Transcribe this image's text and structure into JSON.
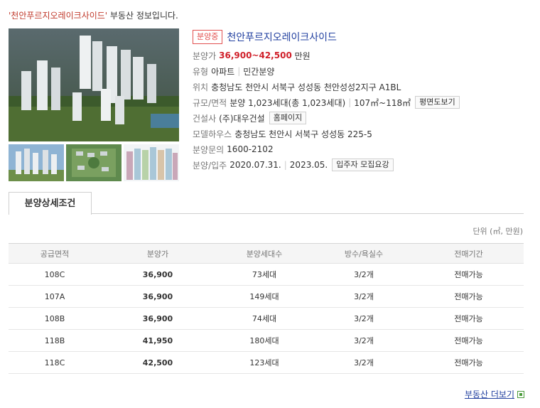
{
  "headline": {
    "name_quoted": "'천안푸르지오레이크사이드'",
    "suffix": " 부동산 정보입니다."
  },
  "property": {
    "status_badge": "분양중",
    "name": "천안푸르지오레이크사이드",
    "price_label": "분양가",
    "price_value": "36,900~42,500",
    "price_unit": "만원",
    "type_label": "유형",
    "type_value": "아파트",
    "type_value2": "민간분양",
    "location_label": "위치",
    "location_value": "충청남도 천안시 서북구 성성동 천안성성2지구 A1BL",
    "scale_label": "규모/면적",
    "scale_value": "분양 1,023세대(총 1,023세대)",
    "area_value": "107㎡~118㎡",
    "floorplan_button": "평면도보기",
    "builder_label": "건설사",
    "builder_value": "(주)대우건설",
    "homepage_button": "홈페이지",
    "model_label": "모델하우스",
    "model_value": "충청남도 천안시 서북구 성성동 225-5",
    "contact_label": "분양문의",
    "contact_value": "1600-2102",
    "dates_label": "분양/입주",
    "sale_date": "2020.07.31.",
    "move_date": "2023.05.",
    "notice_button": "입주자 모집요강"
  },
  "tab": {
    "label": "분양상세조건"
  },
  "unit_note": "단위 (㎡, 만원)",
  "table": {
    "headers": [
      "공급면적",
      "분양가",
      "분양세대수",
      "방수/욕실수",
      "전매기간"
    ],
    "rows": [
      [
        "108C",
        "36,900",
        "73세대",
        "3/2개",
        "전매가능"
      ],
      [
        "107A",
        "36,900",
        "149세대",
        "3/2개",
        "전매가능"
      ],
      [
        "108B",
        "36,900",
        "74세대",
        "3/2개",
        "전매가능"
      ],
      [
        "118B",
        "41,950",
        "180세대",
        "3/2개",
        "전매가능"
      ],
      [
        "118C",
        "42,500",
        "123세대",
        "3/2개",
        "전매가능"
      ]
    ]
  },
  "more_link": "부동산 더보기",
  "colors": {
    "badge": "#e2504f",
    "price": "#d0202a",
    "link": "#2240a0"
  }
}
